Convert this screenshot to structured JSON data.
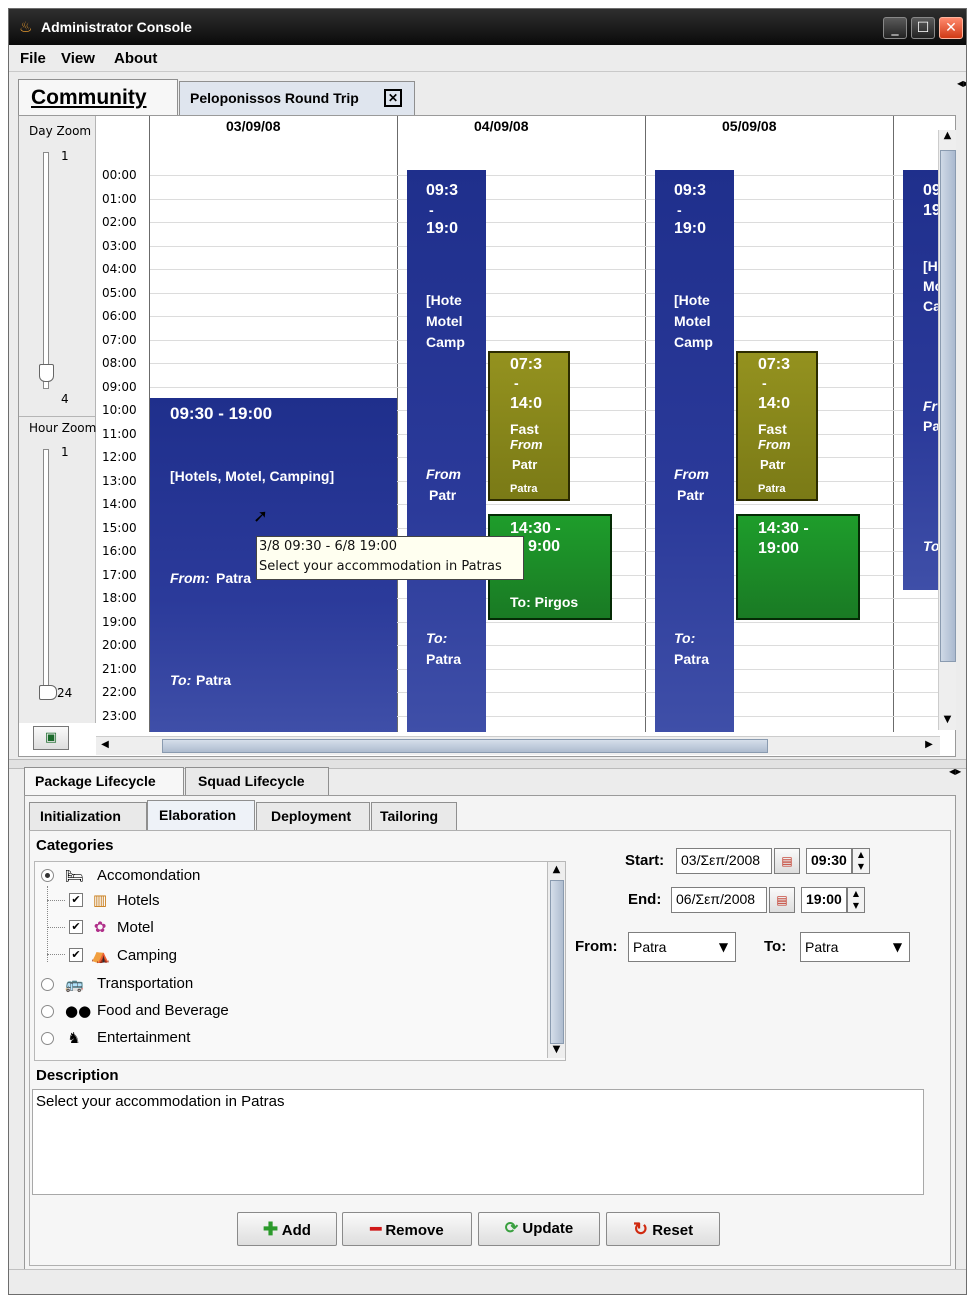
{
  "window": {
    "title": "Administrator Console"
  },
  "menu": [
    "File",
    "View",
    "About"
  ],
  "doc_tabs": {
    "community": "Community",
    "trip": "Peloponissos Round Trip"
  },
  "calendar": {
    "day_zoom": {
      "label": "Day Zoom",
      "min": "1",
      "max": "4",
      "value": 4
    },
    "hour_zoom": {
      "label": "Hour Zoom",
      "min": "1",
      "max": "24",
      "value": 24
    },
    "days": [
      "03/09/08",
      "04/09/08",
      "05/09/08"
    ],
    "hours": [
      "00:00",
      "01:00",
      "02:00",
      "03:00",
      "04:00",
      "05:00",
      "06:00",
      "07:00",
      "08:00",
      "09:00",
      "10:00",
      "11:00",
      "12:00",
      "13:00",
      "14:00",
      "15:00",
      "16:00",
      "17:00",
      "18:00",
      "19:00",
      "20:00",
      "21:00",
      "22:00",
      "23:00"
    ],
    "main_event": {
      "time": "09:30 - 19:00",
      "cats": "[Hotels, Motel, Camping]",
      "from_label": "From:",
      "from": "Patra",
      "to_label": "To:",
      "to": "Patra"
    },
    "col2_event": {
      "l1": "09:3",
      "l2": "-",
      "l3": "19:0",
      "l4": "[Hote",
      "l5": "Motel",
      "l6": "Camp",
      "l7": "From",
      "l8": "Patr",
      "l9": "To:",
      "l10": "Patra"
    },
    "olive_event": {
      "l1": "07:3",
      "l2": "-",
      "l3": "14:0",
      "l4": "Fast",
      "l5": "From",
      "l6": "Patr",
      "l7": "Patra"
    },
    "green_event_a": {
      "l1": "14:30 -",
      "l2": "9:00",
      "l3": "To: Pirgos"
    },
    "green_event_b": {
      "l1": "14:30 -",
      "l2": "19:00"
    },
    "col4_event": {
      "l1": "09",
      "l2": "19",
      "l3": "[H",
      "l4": "Mo",
      "l5": "Ca",
      "l6": "Fr",
      "l7": "Pa",
      "l8": "To"
    },
    "tooltip": {
      "line1": "3/8 09:30 - 6/8 19:00",
      "line2": "Select your accommodation in Patras"
    }
  },
  "lifecycle_tabs": [
    "Package Lifecycle",
    "Squad Lifecycle"
  ],
  "phase_tabs": [
    "Initialization",
    "Elaboration",
    "Deployment",
    "Tailoring"
  ],
  "categories": {
    "label": "Categories",
    "items": [
      {
        "label": "Accomondation",
        "icon": "bed-icon",
        "selected": true
      },
      {
        "label": "Hotels",
        "icon": "hotel-icon",
        "checked": true
      },
      {
        "label": "Motel",
        "icon": "motel-icon",
        "checked": true
      },
      {
        "label": "Camping",
        "icon": "tent-icon",
        "checked": true
      },
      {
        "label": "Transportation",
        "icon": "bus-icon",
        "selected": false
      },
      {
        "label": "Food and Beverage",
        "icon": "food-icon",
        "selected": false
      },
      {
        "label": "Entertainment",
        "icon": "entertainment-icon",
        "selected": false
      }
    ]
  },
  "form": {
    "start_label": "Start:",
    "start_date": "03/Σεπ/2008",
    "start_time": "09:30",
    "end_label": "End:",
    "end_date": "06/Σεπ/2008",
    "end_time": "19:00",
    "from_label": "From:",
    "from_value": "Patra",
    "to_label": "To:",
    "to_value": "Patra"
  },
  "description": {
    "label": "Description",
    "text": "Select your accommodation in Patras"
  },
  "buttons": {
    "add": "Add",
    "remove": "Remove",
    "update": "Update",
    "reset": "Reset"
  },
  "check_mark": "✔"
}
